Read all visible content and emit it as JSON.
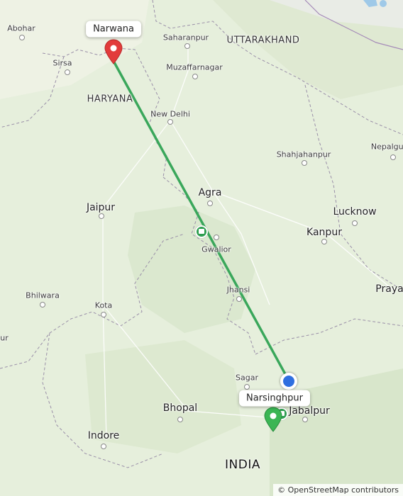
{
  "map": {
    "labels": {
      "abohar": "Abohar",
      "sirsa": "Sirsa",
      "saharanpur": "Saharanpur",
      "uttarakhand": "UTTARAKHAND",
      "muzaffarnagar": "Muzaffarnagar",
      "haryana": "HARYANA",
      "new_delhi": "New Delhi",
      "shahjahanpur": "Shahjahanpur",
      "nepalgunj": "Nepalgur",
      "agra": "Agra",
      "jaipur": "Jaipur",
      "lucknow": "Lucknow",
      "kanpur": "Kanpur",
      "gwalior": "Gwalior",
      "bhilwara": "Bhilwara",
      "kota": "Kota",
      "jhansi": "Jhansi",
      "prayagraj": "Praya",
      "sagar": "Sagar",
      "jabalpur": "Jabalpur",
      "bhopal": "Bhopal",
      "indore": "Indore",
      "india": "INDIA",
      "left_edge": "ur"
    },
    "origin_tag": "Narwana",
    "destination_tag": "Narsinghpur",
    "attribution": "© OpenStreetMap contributors",
    "colors": {
      "route": "#3aa75b",
      "origin_pin": "#e23b3b",
      "destination_pin": "#3bb554",
      "current_location": "#2f6fe0"
    }
  }
}
